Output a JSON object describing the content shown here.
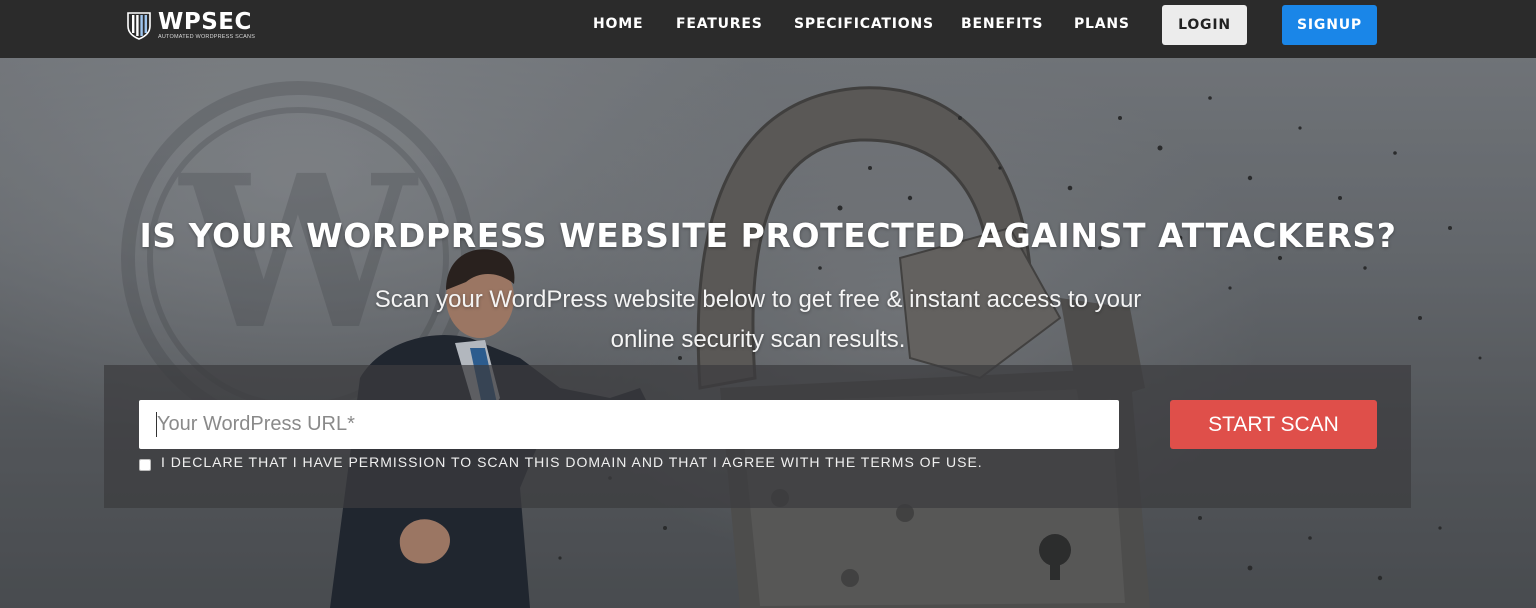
{
  "brand": {
    "name": "WPSEC",
    "tagline": "AUTOMATED WORDPRESS SCANS",
    "logo_icon": "shield-stripes-icon"
  },
  "nav": {
    "items": [
      {
        "label": "HOME"
      },
      {
        "label": "FEATURES"
      },
      {
        "label": "SPECIFICATIONS"
      },
      {
        "label": "BENEFITS"
      },
      {
        "label": "PLANS"
      }
    ],
    "login_label": "LOGIN",
    "signup_label": "SIGNUP"
  },
  "hero": {
    "headline": "IS YOUR WORDPRESS WEBSITE PROTECTED AGAINST ATTACKERS?",
    "subline": "Scan your WordPress website below to get free & instant access to your online security scan results.",
    "background_art": [
      "wordpress-logo-watermark",
      "broken-padlock",
      "businessman"
    ]
  },
  "scan_form": {
    "url_placeholder": "Your WordPress URL*",
    "url_value": "",
    "start_label": "START SCAN",
    "declaration": "I DECLARE THAT I HAVE PERMISSION TO SCAN THIS DOMAIN AND THAT I AGREE WITH THE TERMS OF USE.",
    "declaration_checked": false
  },
  "colors": {
    "navbar": "#2b2b2b",
    "signup": "#1a86e8",
    "login": "#ececec",
    "start_scan": "#df4f4a"
  }
}
